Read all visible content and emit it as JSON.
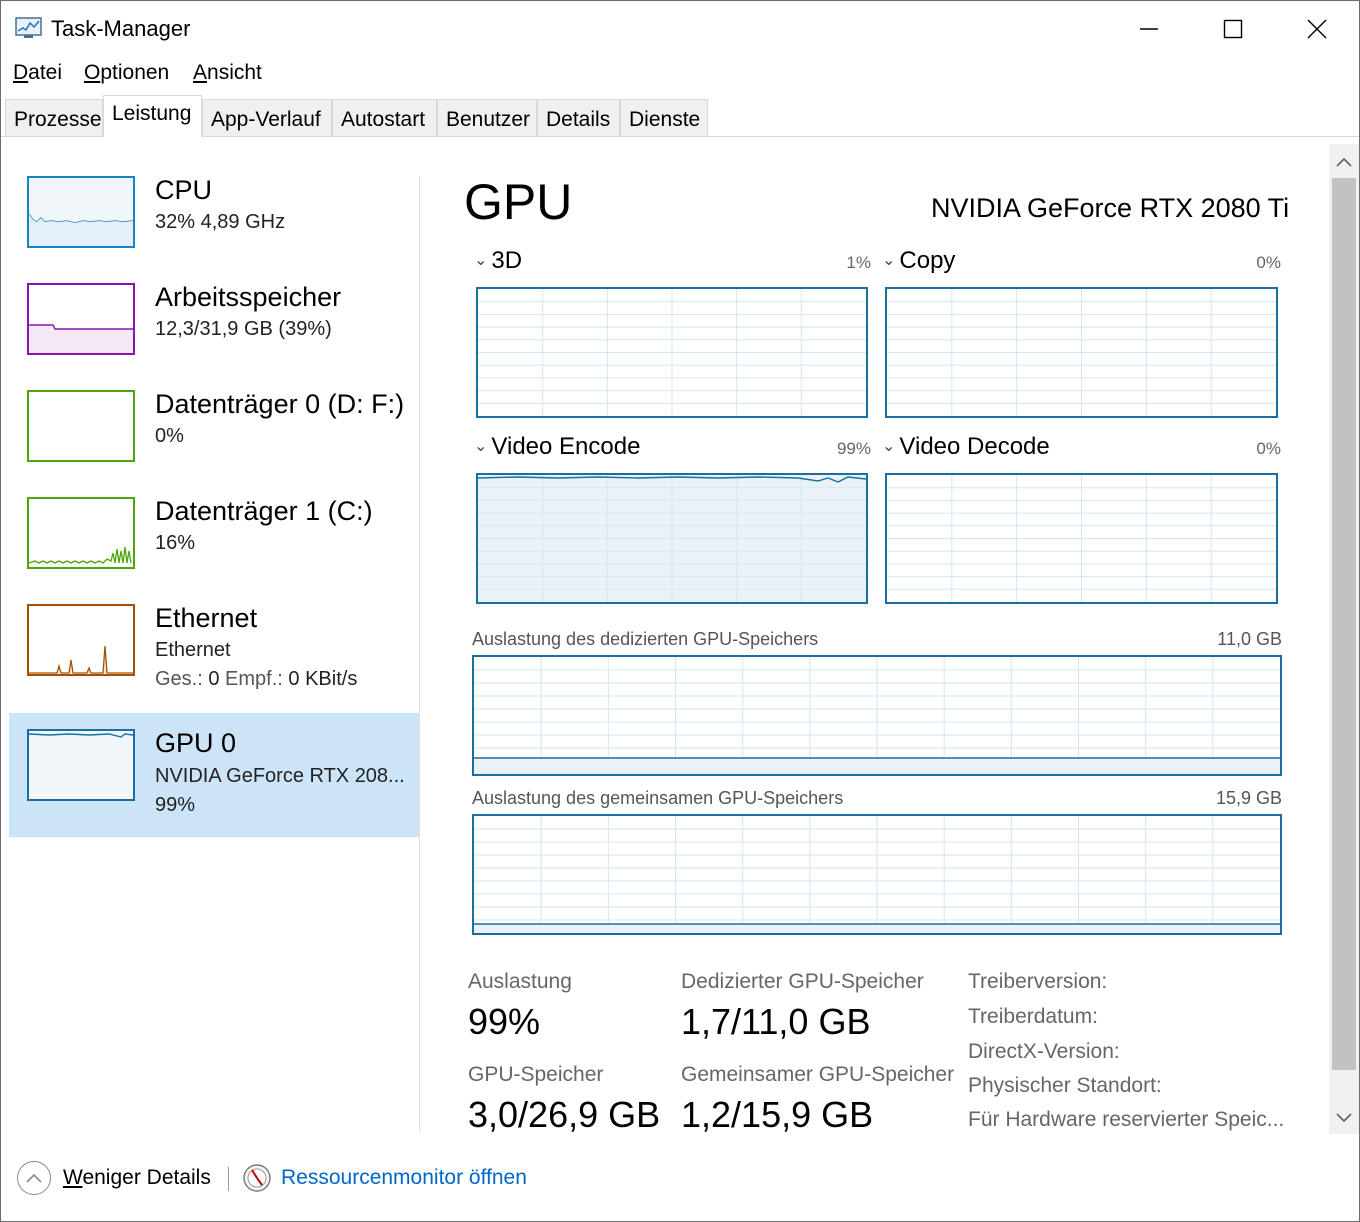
{
  "window": {
    "title": "Task-Manager",
    "icon": "task-manager-icon"
  },
  "menu": {
    "items": [
      {
        "underline": "D",
        "rest": "atei"
      },
      {
        "underline": "O",
        "rest": "ptionen"
      },
      {
        "underline": "A",
        "rest": "nsicht"
      }
    ]
  },
  "tabs": {
    "items": [
      "Prozesse",
      "Leistung",
      "App-Verlauf",
      "Autostart",
      "Benutzer",
      "Details",
      "Dienste"
    ],
    "active": "Leistung"
  },
  "sidebar": {
    "items": [
      {
        "title": "CPU",
        "line1": "32% 4,89 GHz",
        "color": "#1883c4"
      },
      {
        "title": "Arbeitsspeicher",
        "line1": "12,3/31,9 GB (39%)",
        "color": "#8b12ae"
      },
      {
        "title": "Datenträger 0 (D: F:)",
        "line1": "0%",
        "color": "#4da60c"
      },
      {
        "title": "Datenträger 1 (C:)",
        "line1": "16%",
        "color": "#4da60c"
      },
      {
        "title": "Ethernet",
        "line1": "Ethernet",
        "send_label": "Ges.:",
        "send_value": "0",
        "recv_label": "Empf.:",
        "recv_value": "0 KBit/s",
        "color": "#a74f01"
      },
      {
        "title": "GPU 0",
        "line1": "NVIDIA GeForce RTX 208...",
        "line2": "99%",
        "color": "#1a6ea0"
      }
    ]
  },
  "main": {
    "title": "GPU",
    "device": "NVIDIA GeForce RTX 2080 Ti",
    "graphs": [
      {
        "name": "3D",
        "pct": "1%",
        "value": 1
      },
      {
        "name": "Copy",
        "pct": "0%",
        "value": 0
      },
      {
        "name": "Video Encode",
        "pct": "99%",
        "value": 99
      },
      {
        "name": "Video Decode",
        "pct": "0%",
        "value": 0
      }
    ],
    "dedicated": {
      "label": "Auslastung des dedizierten GPU-Speichers",
      "max": "11,0 GB"
    },
    "shared": {
      "label": "Auslastung des gemeinsamen GPU-Speichers",
      "max": "15,9 GB"
    },
    "stats": {
      "util_label": "Auslastung",
      "util_value": "99%",
      "ded_label": "Dedizierter GPU-Speicher",
      "ded_value": "1,7/11,0 GB",
      "gpumem_label": "GPU-Speicher",
      "gpumem_value": "3,0/26,9 GB",
      "shared_label": "Gemeinsamer GPU-Speicher",
      "shared_value": "1,2/15,9 GB"
    },
    "info": [
      "Treiberversion:",
      "Treiberdatum:",
      "DirectX-Version:",
      "Physischer Standort:",
      "Für Hardware reservierter Speic..."
    ]
  },
  "footer": {
    "less_underline": "W",
    "less_rest": "eniger Details",
    "resmon": "Ressourcenmonitor öffnen"
  }
}
